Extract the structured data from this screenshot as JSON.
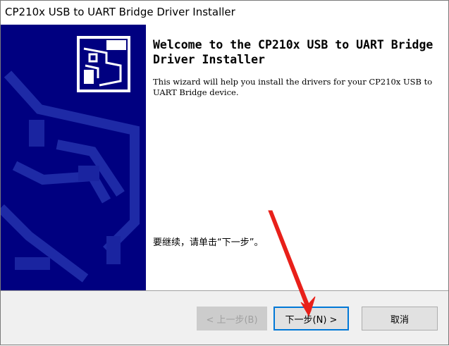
{
  "window": {
    "title": "CP210x USB to UART Bridge Driver Installer"
  },
  "welcome": {
    "heading": "Welcome to the CP210x USB to UART Bridge Driver Installer",
    "description": "This wizard will help you install the drivers for your CP210x USB to UART Bridge device.",
    "continue_text": "要继续，请单击“下一步”。"
  },
  "buttons": {
    "back_label": "< 上一步(B)",
    "next_label": "下一步(N) >",
    "cancel_label": "取消"
  },
  "colors": {
    "side_panel": "#000080",
    "annotation_arrow": "#e8201a",
    "focus_border": "#0078d7"
  },
  "icons": {
    "side_graphic": "usb-device-icon",
    "annotation": "red-arrow"
  }
}
